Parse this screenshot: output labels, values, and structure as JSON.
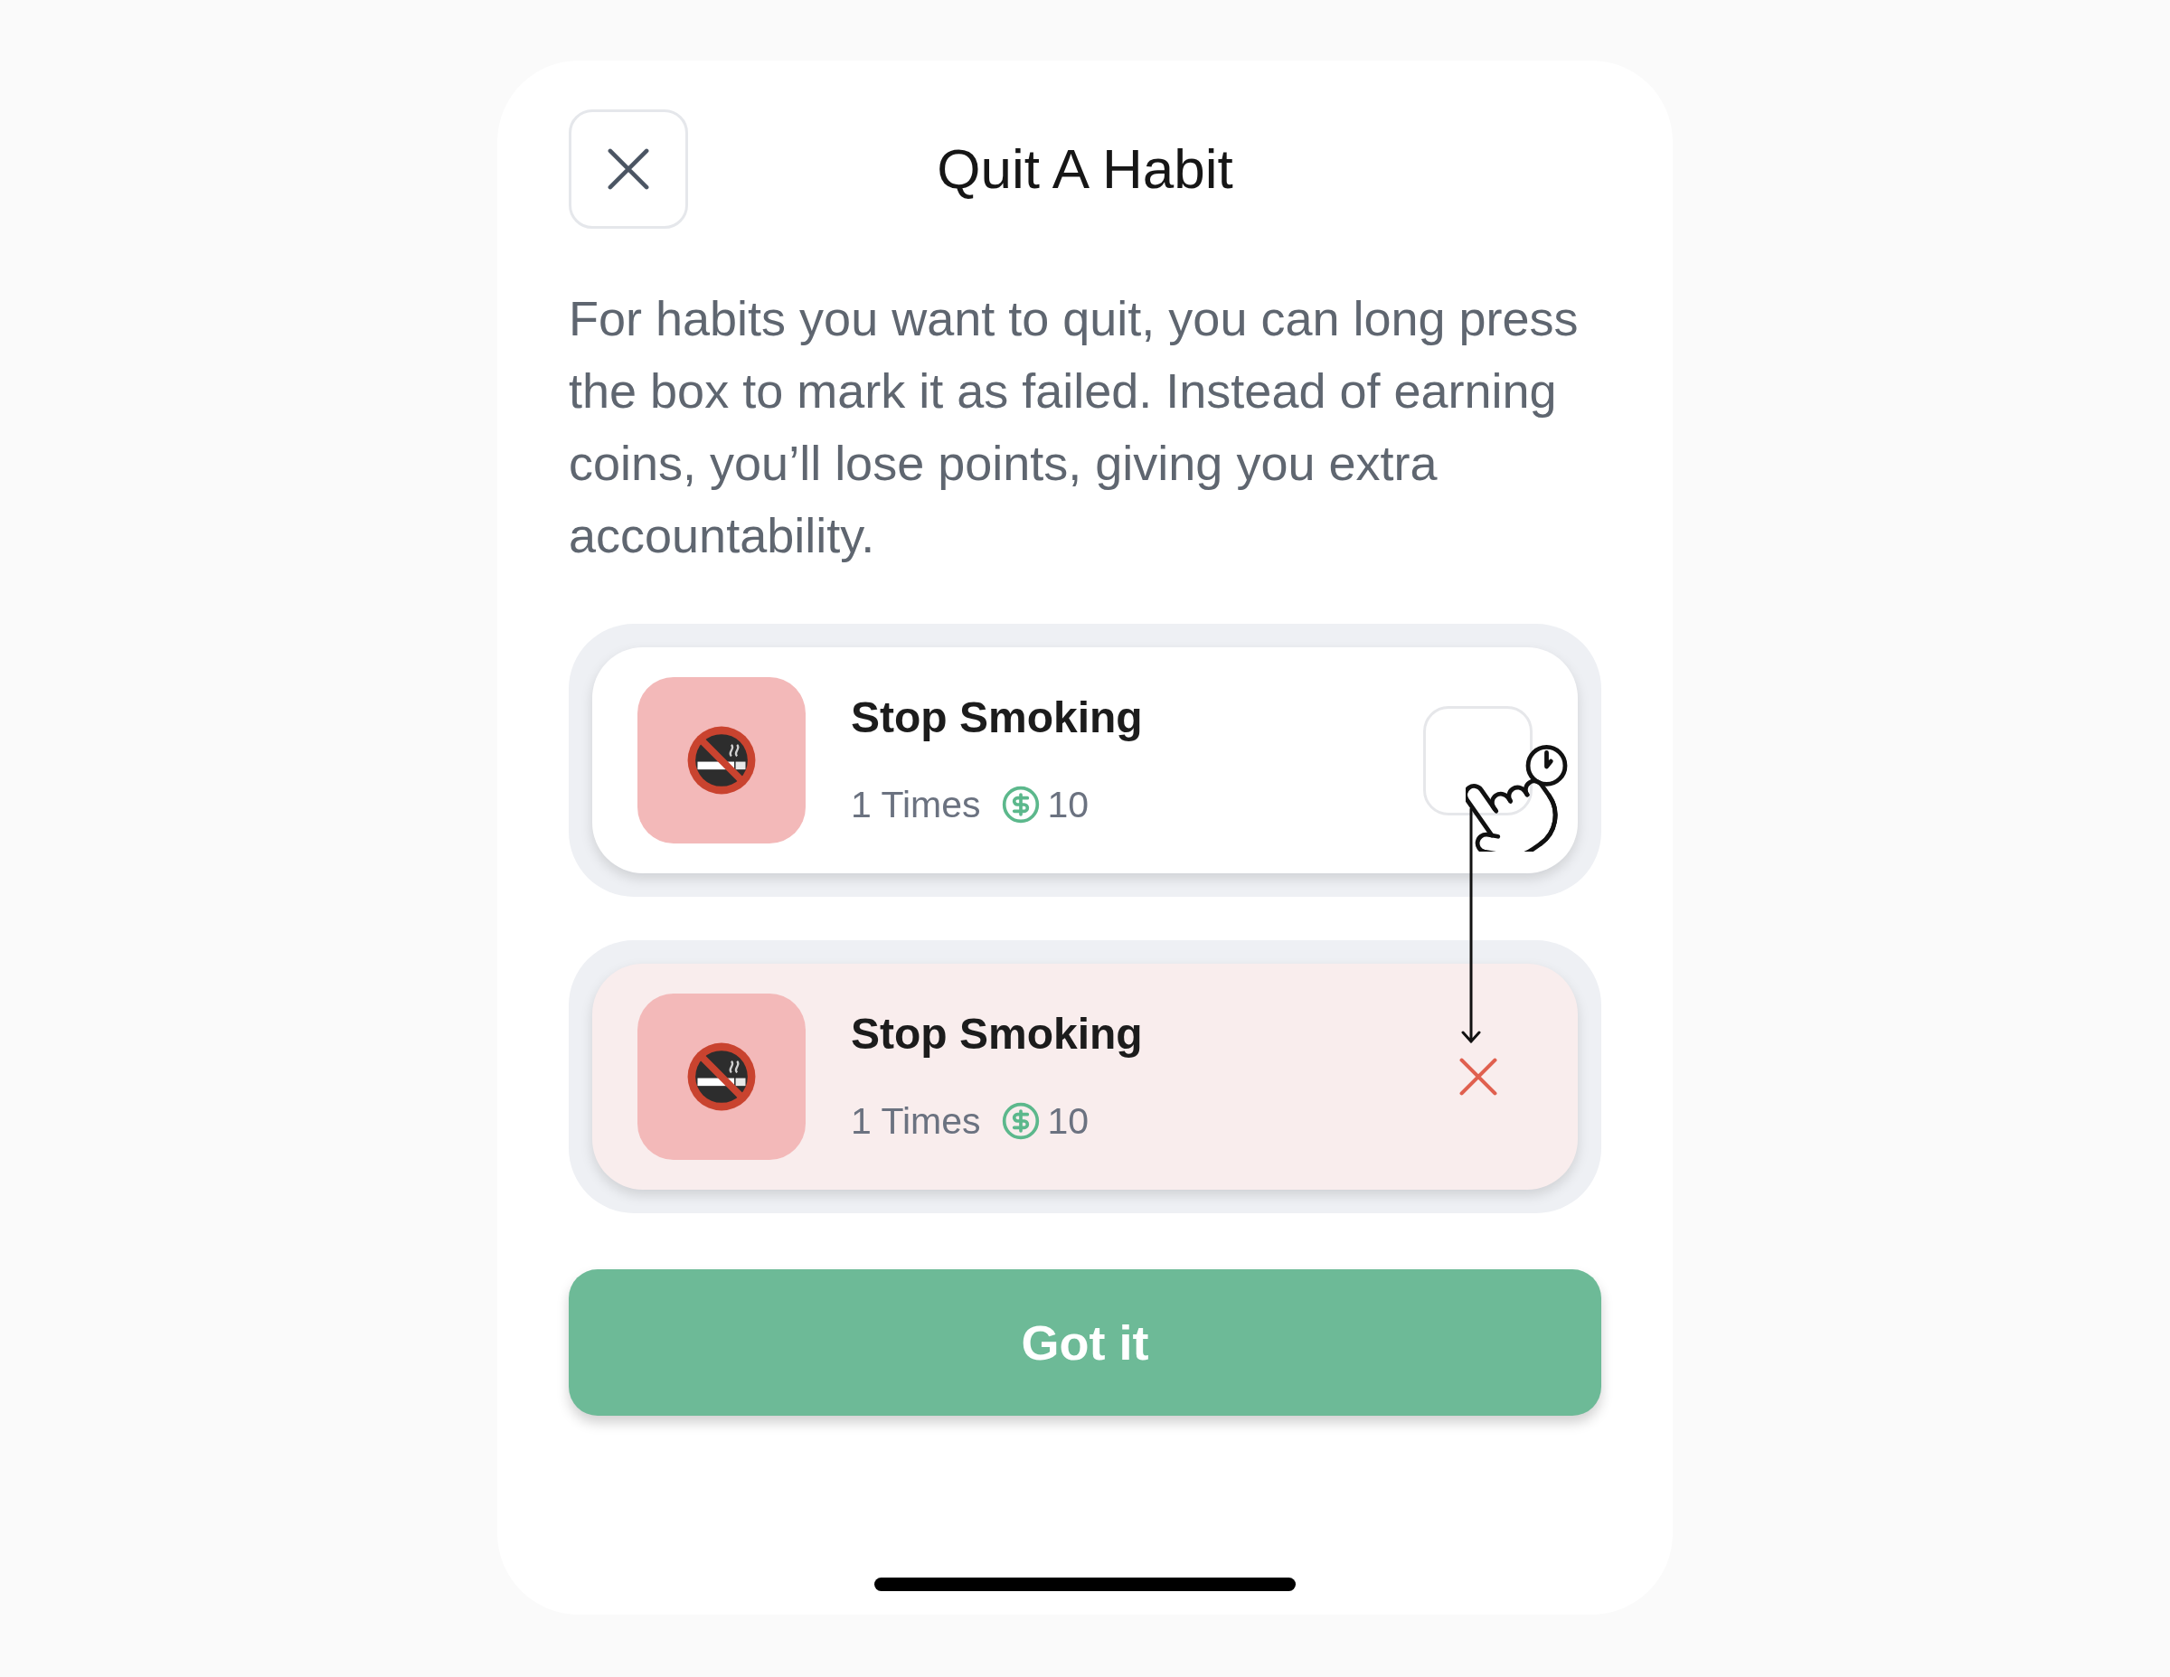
{
  "dialog": {
    "title": "Quit A Habit",
    "description": "For habits you want to quit, you can long press the box to mark it as failed. Instead of earning coins, you’ll lose points, giving you extra accountability.",
    "examples": [
      {
        "name": "Stop Smoking",
        "count": "1 Times",
        "coins": "10",
        "failed": false
      },
      {
        "name": "Stop Smoking",
        "count": "1 Times",
        "coins": "10",
        "failed": true
      }
    ],
    "confirm_button": {
      "label": "Got it"
    }
  }
}
